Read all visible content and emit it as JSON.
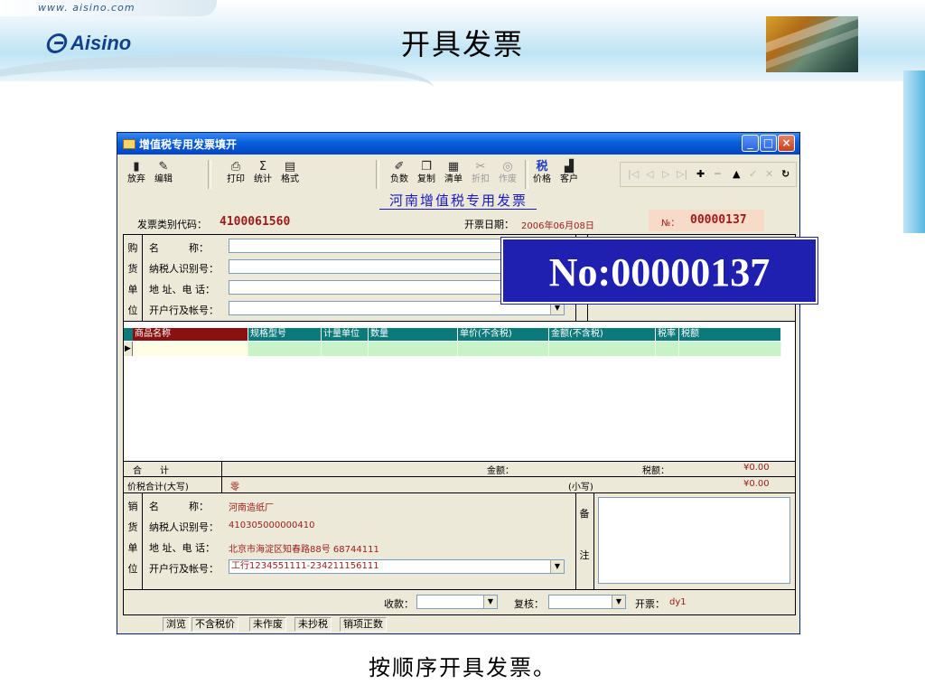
{
  "slide": {
    "url": "www. aisino.com",
    "logo_text": "Aisino",
    "title": "开具发票",
    "caption": "按顺序开具发票。",
    "overlay_number": "No:00000137"
  },
  "window": {
    "title": "增值税专用发票填开",
    "min_icon": "minimize-icon",
    "max_icon": "maximize-icon",
    "close_icon": "close-icon"
  },
  "toolbar": {
    "abandon": "放弃",
    "edit": "编辑",
    "print": "打印",
    "stats": "统计",
    "format": "格式",
    "negative": "负数",
    "copy": "复制",
    "list": "清单",
    "discount": "折扣",
    "void": "作废",
    "price": "价格",
    "customer": "客户"
  },
  "invoice": {
    "heading": "河南增值税专用发票",
    "code_label": "发票类别代码：",
    "code_value": "4100061560",
    "date_label": "开票日期：",
    "date_value": "2006年06月08日",
    "no_prefix": "№：",
    "no_value": "00000137"
  },
  "buyer": {
    "side_chars": [
      "购",
      "货",
      "单",
      "位"
    ],
    "labels": [
      "名　　　称：",
      "纳税人识别号：",
      "地 址、电 话：",
      "开户行及帐号："
    ],
    "values": [
      "",
      "",
      "",
      ""
    ]
  },
  "grid": {
    "columns": [
      "商品名称",
      "规格型号",
      "计量单位",
      "数量",
      "单价(不含税)",
      "金额(不含税)",
      "税率",
      "税额"
    ]
  },
  "totals": {
    "total_label": "合　　计",
    "amount_label": "金额：",
    "tax_label": "税额：",
    "tax_value": "¥0.00",
    "grand_label": "价税合计(大写)",
    "grand_upper": "零",
    "small_label": "(小写)",
    "small_value": "¥0.00"
  },
  "seller": {
    "side_chars": [
      "销",
      "货",
      "单",
      "位"
    ],
    "labels": [
      "名　　　称：",
      "纳税人识别号：",
      "地 址、电 话：",
      "开户行及帐号："
    ],
    "values": [
      "河南造纸厂",
      "410305000000410",
      "北京市海淀区知春路88号 68744111",
      "工行1234551111-234211156111"
    ],
    "remark_chars": [
      "备",
      "注"
    ]
  },
  "footer": {
    "payee_label": "收款：",
    "checker_label": "复核：",
    "issuer_label": "开票：",
    "issuer_value": "dy1"
  },
  "status": [
    "浏览",
    "不含税价",
    "未作废",
    "未抄税",
    "销项正数"
  ],
  "colors": {
    "accent_blue": "#1f1fb0",
    "value_red": "#9c1a1a",
    "grid_header": "#0a7a7a",
    "grid_row": "#c8f2c8"
  }
}
